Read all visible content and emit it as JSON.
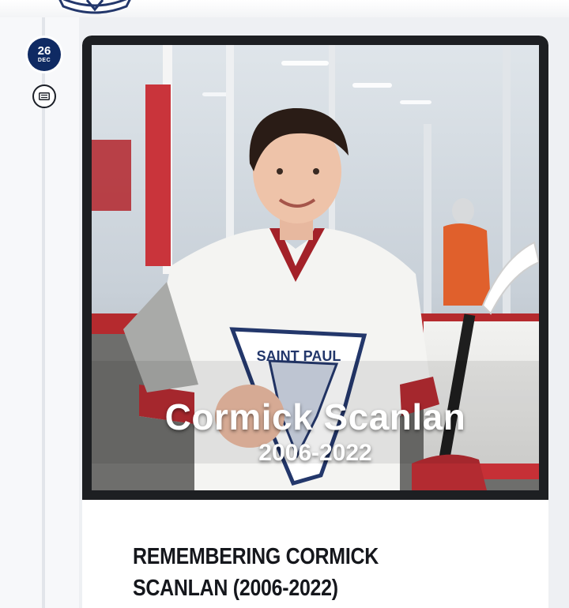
{
  "post": {
    "date_day": "26",
    "date_month": "DEC",
    "image_overlay_name": "Cormick Scanlan",
    "image_overlay_years": "2006-2022",
    "title": "REMEMBERING CORMICK SCANLAN (2006-2022)",
    "jersey_text": "SAINT PAUL"
  },
  "colors": {
    "date_badge": "#0f2a63",
    "card_bg": "#ffffff",
    "page_bg": "#eef0f3"
  },
  "icons": {
    "post_type": "newspaper-icon",
    "site_logo": "team-logo"
  }
}
